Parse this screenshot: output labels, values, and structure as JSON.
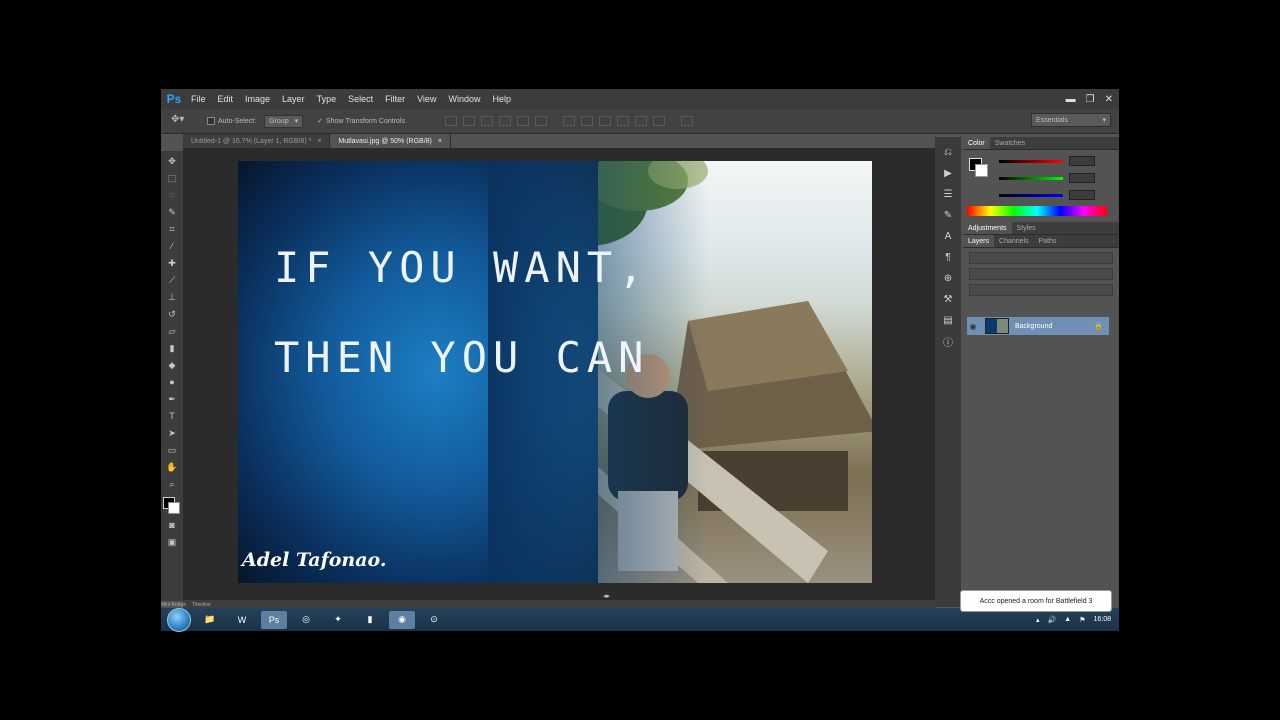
{
  "app": {
    "logo": "Ps"
  },
  "menu": [
    "File",
    "Edit",
    "Image",
    "Layer",
    "Type",
    "Select",
    "Filter",
    "View",
    "Window",
    "Help"
  ],
  "window_controls": {
    "minimize": "▬",
    "restore": "❐",
    "close": "✕"
  },
  "options": {
    "auto_select_label": "Auto-Select:",
    "auto_select_value": "Group",
    "transform_label": "Show Transform Controls",
    "workspace": "Essentials"
  },
  "tabs": [
    {
      "label": "Untitled-1 @ 16.7% (Layer 1, RGB/8) *",
      "close": "×"
    },
    {
      "label": "Mutlavasi.jpg @ 50% (RGB/8)",
      "close": "×"
    }
  ],
  "artwork": {
    "line1": "IF YOU WANT,",
    "line2": "THEN YOU CAN",
    "signature": "Adel Tafonao."
  },
  "panels": {
    "color_tabs": [
      "Color",
      "Swatches"
    ],
    "adjust_tabs": [
      "Adjustments",
      "Styles"
    ],
    "layer_tabs": [
      "Layers",
      "Channels",
      "Paths"
    ],
    "layer_name": "Background"
  },
  "bottom_tabs": [
    "Mini Bridge",
    "Timeline"
  ],
  "notification": "Accc opened a room for Battlefield 3",
  "clock": "16:08",
  "colors": {
    "accent": "#2fa3f5",
    "layer_selected": "#6f8fb5",
    "panel_bg": "#535353",
    "menu_bg": "#3c3c3c"
  }
}
